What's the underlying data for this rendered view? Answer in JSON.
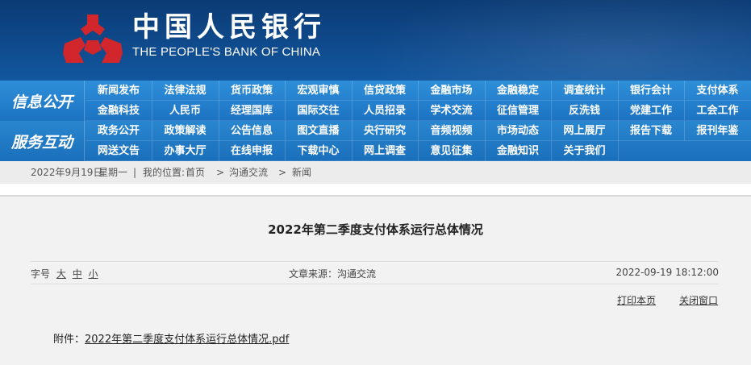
{
  "header": {
    "name_cn": "中国人民银行",
    "name_en": "THE PEOPLE'S BANK OF CHINA",
    "emblem_color": "#d0262c"
  },
  "nav": {
    "info_heading": "信息公开",
    "service_heading": "服务互动",
    "info_items": [
      "新闻发布",
      "法律法规",
      "货币政策",
      "宏观审慎",
      "信贷政策",
      "金融市场",
      "金融稳定",
      "调查统计",
      "银行会计",
      "支付体系",
      "金融科技",
      "人民币",
      "经理国库",
      "国际交往",
      "人员招录",
      "学术交流",
      "征信管理",
      "反洗钱",
      "党建工作",
      "工会工作"
    ],
    "service_items": [
      "政务公开",
      "政策解读",
      "公告信息",
      "图文直播",
      "央行研究",
      "音频视频",
      "市场动态",
      "网上展厅",
      "报告下载",
      "报刊年鉴",
      "网送文告",
      "办事大厅",
      "在线申报",
      "下载中心",
      "网上调查",
      "意见征集",
      "金融知识",
      "关于我们"
    ]
  },
  "breadcrumb": {
    "date": "2022年9月19日",
    "weekday": "星期一",
    "sep": "|",
    "location_label": "我的位置:",
    "home": "首页",
    "level1": "沟通交流",
    "level2": "新闻",
    "arrow": ">"
  },
  "article": {
    "title": "2022年第二季度支付体系运行总体情况",
    "font_size_label": "字号",
    "font_large": "大",
    "font_medium": "中",
    "font_small": "小",
    "source": "文章来源：沟通交流",
    "datetime": "2022-09-19  18:12:00",
    "print_link": "打印本页",
    "close_link": "关闭窗口",
    "attachment_label": "附件：",
    "attachment_name": "2022年第二季度支付体系运行总体情况.pdf"
  }
}
